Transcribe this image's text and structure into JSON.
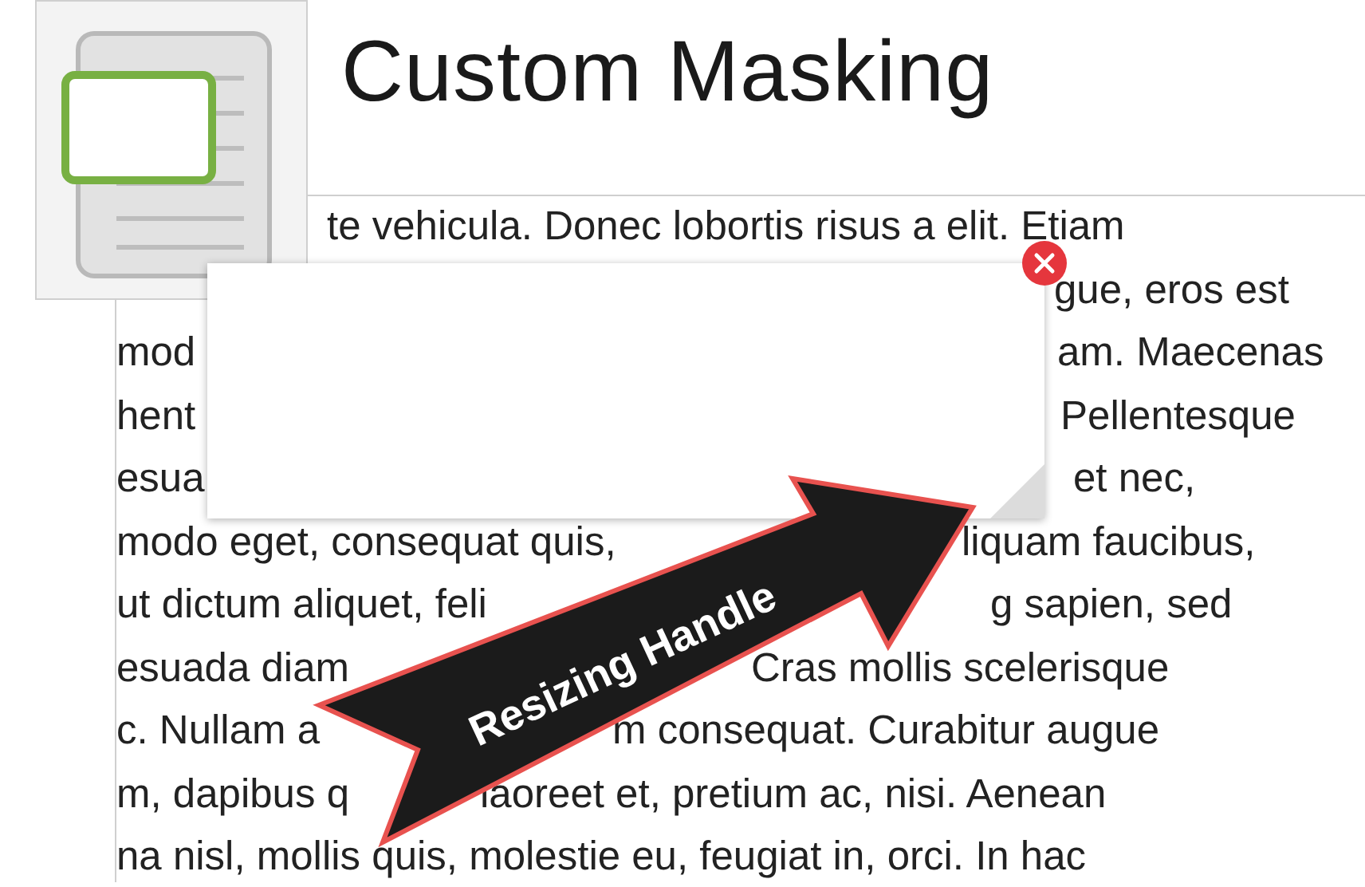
{
  "title": "Custom Masking",
  "document_lines": [
    {
      "right": "te vehicula. Donec lobortis risus a elit. Etiam"
    },
    {
      "right": "gue, eros est"
    },
    {
      "left": "mod",
      "right": "am. Maecenas"
    },
    {
      "left": "hent",
      "right": "Pellentesque"
    },
    {
      "left": "esua",
      "right": "et nec,"
    },
    {
      "left": "modo eget, consequat quis,",
      "right": "liquam faucibus,"
    },
    {
      "left": "ut dictum aliquet, feli",
      "right": "g sapien, sed"
    },
    {
      "left": "esuada diam",
      "right": "Cras mollis scelerisque"
    },
    {
      "left": "c. Nullam a",
      "right": "m consequat. Curabitur augue"
    },
    {
      "left": "m, dapibus q",
      "right": "laoreet et, pretium ac, nisi. Aenean"
    },
    {
      "left": "na nisl, mollis quis, molestie eu, feugiat in, orci. In hac"
    }
  ],
  "callout": {
    "text": "Resizing Handle"
  }
}
